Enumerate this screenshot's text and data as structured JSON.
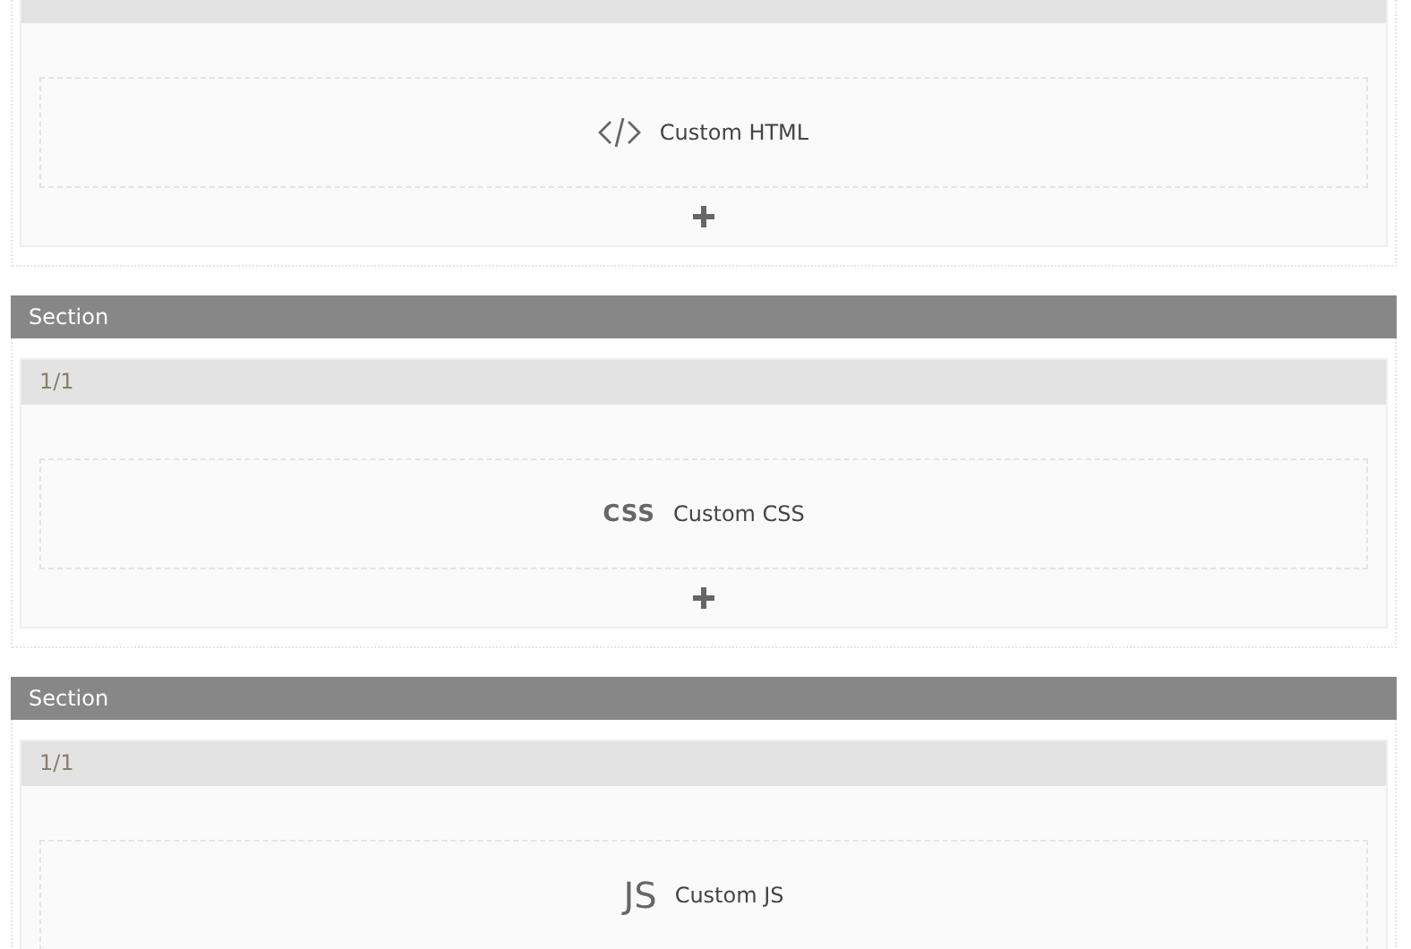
{
  "sections": [
    {
      "element": {
        "kind": "html",
        "label": "Custom HTML"
      },
      "add_button": true
    },
    {
      "title": "Section",
      "column": {
        "label": "1/1"
      },
      "element": {
        "kind": "css",
        "icon_text": "CSS",
        "label": "Custom CSS"
      },
      "add_button": true
    },
    {
      "title": "Section",
      "column": {
        "label": "1/1"
      },
      "element": {
        "kind": "js",
        "icon_text": "JS",
        "label": "Custom JS"
      }
    }
  ]
}
